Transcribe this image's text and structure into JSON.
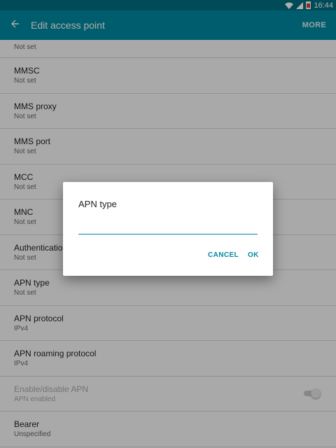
{
  "status_bar": {
    "time": "16:44"
  },
  "toolbar": {
    "title": "Edit access point",
    "more_label": "MORE"
  },
  "list": {
    "items": [
      {
        "title": "",
        "subtitle": "Not set"
      },
      {
        "title": "MMSC",
        "subtitle": "Not set"
      },
      {
        "title": "MMS proxy",
        "subtitle": "Not set"
      },
      {
        "title": "MMS port",
        "subtitle": "Not set"
      },
      {
        "title": "MCC",
        "subtitle": "Not set"
      },
      {
        "title": "MNC",
        "subtitle": "Not set"
      },
      {
        "title": "Authentication",
        "subtitle": "Not set"
      },
      {
        "title": "APN type",
        "subtitle": "Not set"
      },
      {
        "title": "APN protocol",
        "subtitle": "IPv4"
      },
      {
        "title": "APN roaming protocol",
        "subtitle": "IPv4"
      },
      {
        "title": "Enable/disable APN",
        "subtitle": "APN enabled",
        "toggle_on": true
      },
      {
        "title": "Bearer",
        "subtitle": "Unspecified"
      }
    ]
  },
  "dialog": {
    "title": "APN type",
    "input_value": "",
    "cancel_label": "CANCEL",
    "ok_label": "OK"
  },
  "colors": {
    "accent": "#0089a1",
    "statusbar": "#006f82"
  }
}
